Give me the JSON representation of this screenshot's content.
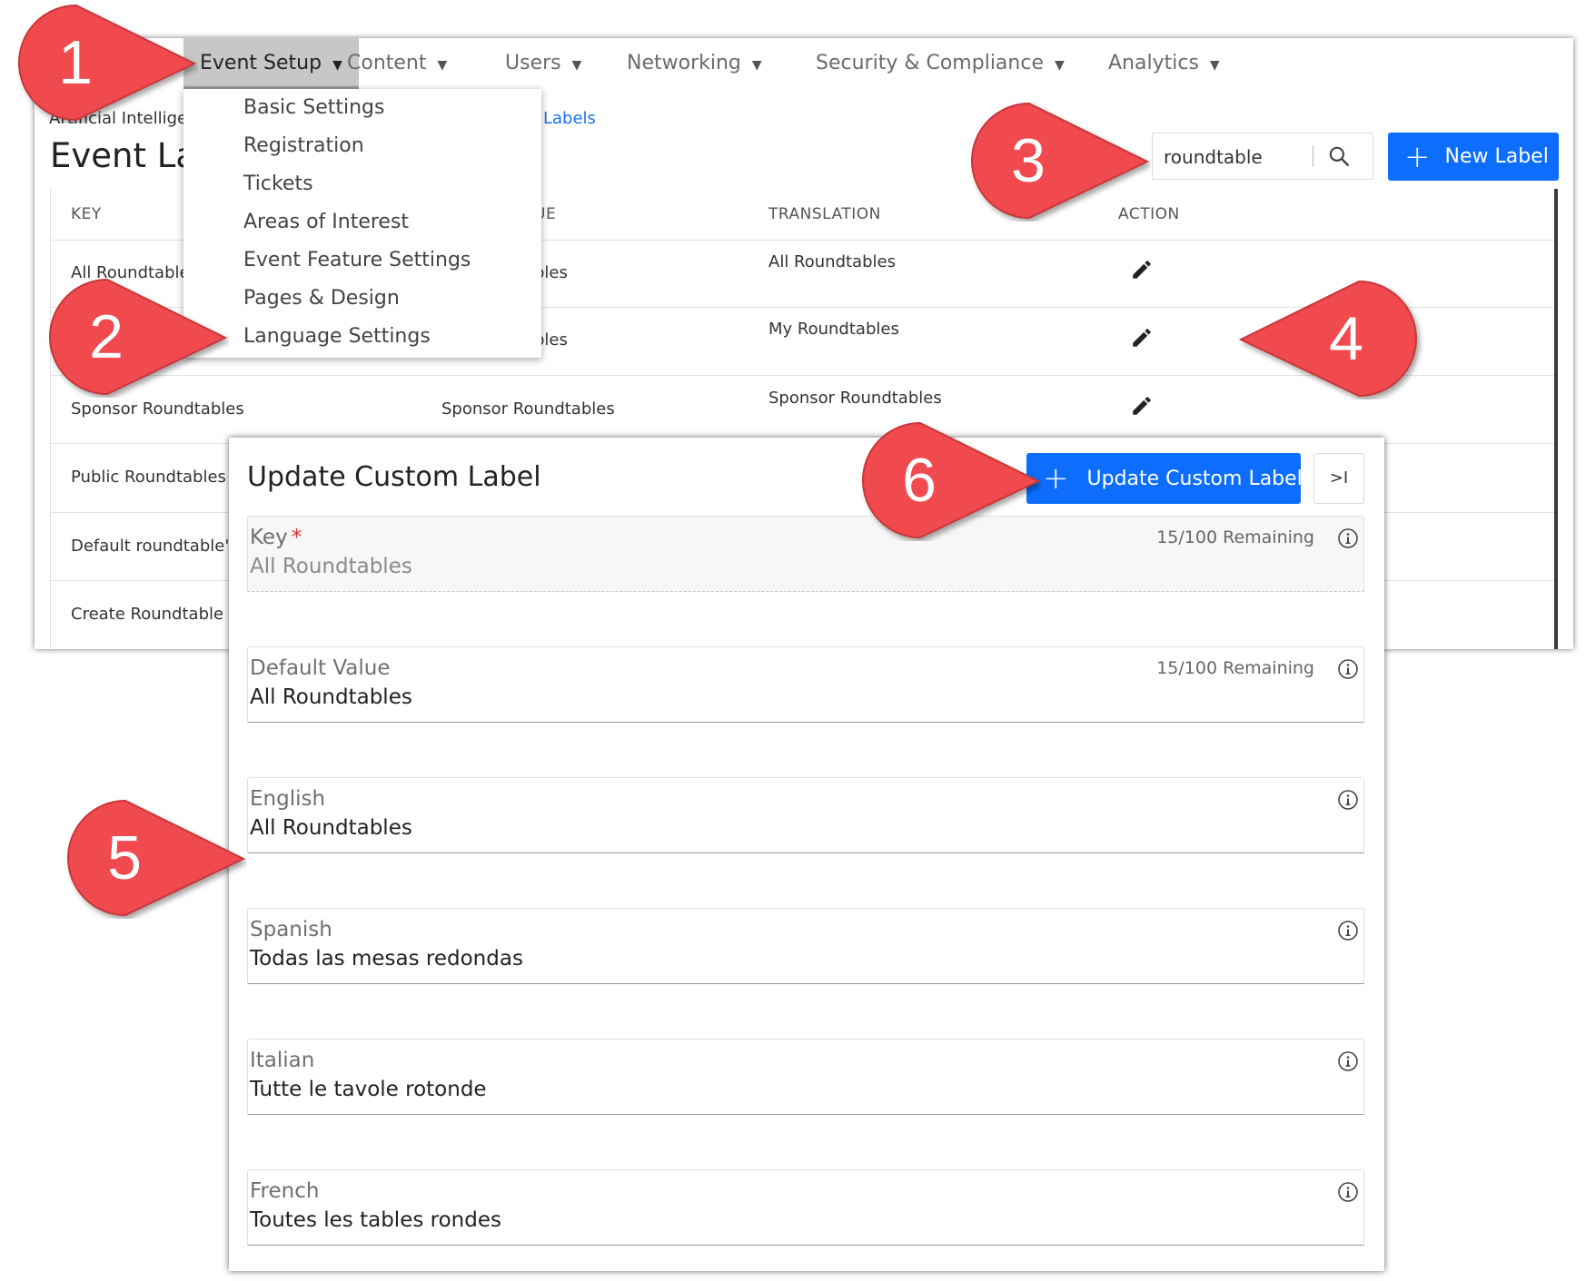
{
  "nav": {
    "items": [
      {
        "label": "Event Setup"
      },
      {
        "label": "Content"
      },
      {
        "label": "Users"
      },
      {
        "label": "Networking"
      },
      {
        "label": "Security & Compliance"
      },
      {
        "label": "Analytics"
      }
    ]
  },
  "dropdown": {
    "items": [
      "Basic Settings",
      "Registration",
      "Tickets",
      "Areas of Interest",
      "Event Feature Settings",
      "Pages & Design",
      "Language Settings"
    ]
  },
  "breadcrumb": {
    "first": "Artificial Intellige",
    "last": "Labels"
  },
  "page_title": "Event La",
  "search": {
    "value": "roundtable"
  },
  "new_label_button": "New Label",
  "table": {
    "headers": {
      "key": "KEY",
      "default_value": "UE",
      "translation": "TRANSLATION",
      "action": "ACTION"
    },
    "rows": [
      {
        "key": "All Roundtable",
        "default_value": "bles",
        "translation": "All Roundtables"
      },
      {
        "key": "",
        "default_value": "bles",
        "translation": "My Roundtables"
      },
      {
        "key": "Sponsor Roundtables",
        "default_value": "Sponsor Roundtables",
        "translation": "Sponsor Roundtables"
      },
      {
        "key": "Public Roundtables",
        "default_value": "",
        "translation": ""
      },
      {
        "key": "Default roundtable'",
        "default_value": "",
        "translation": ""
      },
      {
        "key": "Create Roundtable",
        "default_value": "",
        "translation": ""
      }
    ]
  },
  "modal": {
    "title": "Update Custom Label",
    "update_button": "Update Custom Label",
    "collapse_button": ">I",
    "fields": [
      {
        "label": "Key",
        "required_mark": "*",
        "value": "All Roundtables",
        "counter": "15/100 Remaining"
      },
      {
        "label": "Default Value",
        "value": "All Roundtables",
        "counter": "15/100 Remaining"
      },
      {
        "label": "English",
        "value": "All Roundtables"
      },
      {
        "label": "Spanish",
        "value": "Todas las mesas redondas"
      },
      {
        "label": "Italian",
        "value": "Tutte le tavole rotonde"
      },
      {
        "label": "French",
        "value": "Toutes les tables rondes"
      }
    ]
  },
  "callouts": {
    "n1": "1",
    "n2": "2",
    "n3": "3",
    "n4": "4",
    "n5": "5",
    "n6": "6"
  },
  "colors": {
    "callout": "#f04a4e",
    "primary": "#0d6efd",
    "link": "#1a73e8"
  },
  "icons": {
    "search": "search-icon",
    "edit": "pencil-icon",
    "info": "info-icon",
    "plus": "plus-icon",
    "caret": "caret-down-icon"
  }
}
